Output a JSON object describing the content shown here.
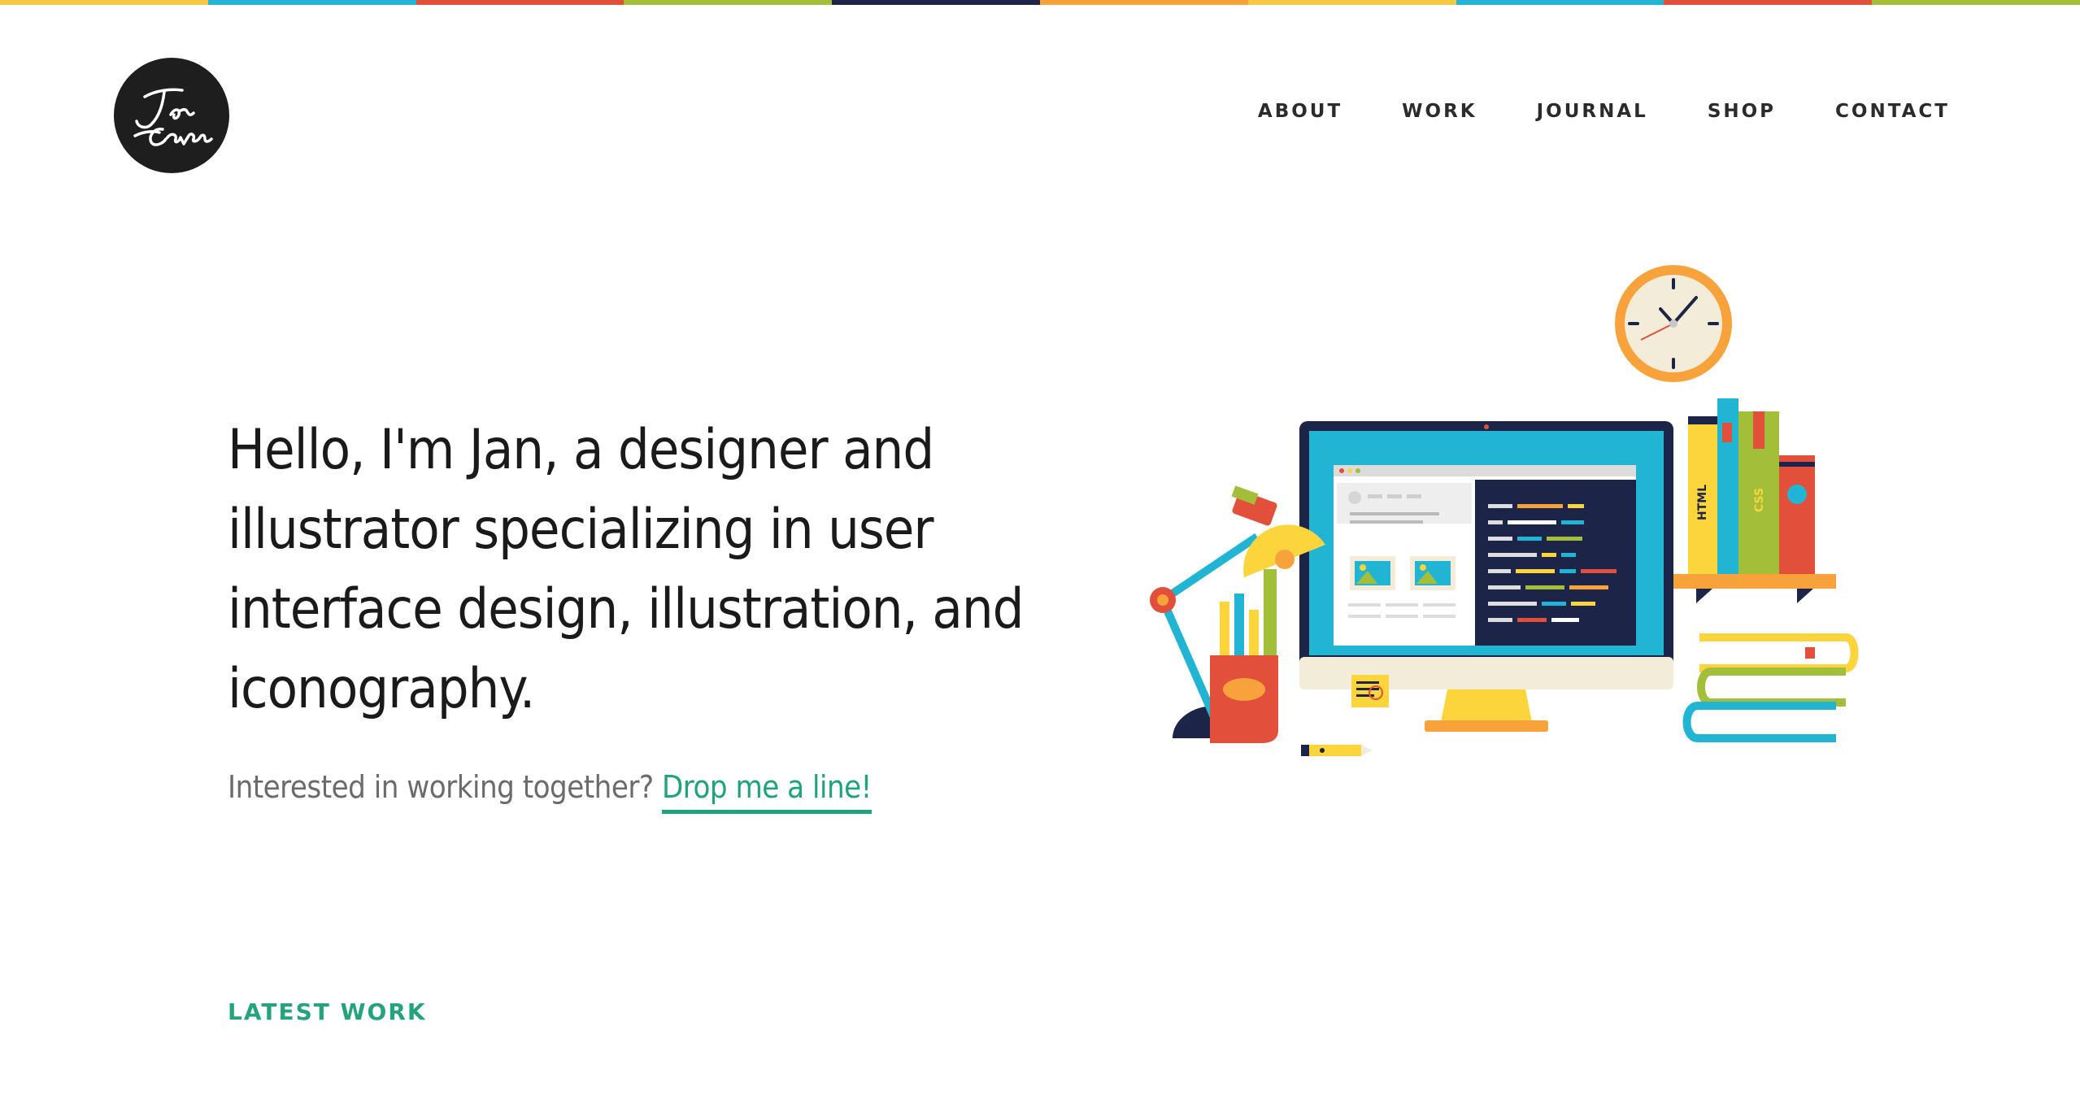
{
  "logo": {
    "text": "Jan Cavan",
    "color": "#1e1e1e"
  },
  "topbar_colors": [
    "#f7c843",
    "#22b5d3",
    "#e2503b",
    "#a3bf3a",
    "#1c2547",
    "#f7a23b",
    "#f7c843",
    "#22b5d3",
    "#e2503b",
    "#a3bf3a"
  ],
  "nav": {
    "about": "ABOUT",
    "work": "WORK",
    "journal": "JOURNAL",
    "shop": "SHOP",
    "contact": "CONTACT"
  },
  "hero": {
    "headline": "Hello, I'm Jan, a designer and illustrator specializing in user interface design, illustration, and iconography.",
    "cta_prefix": "Interested in working together?",
    "cta_link": "Drop me a line!"
  },
  "section": {
    "latest_work": "LATEST WORK"
  },
  "illustration": {
    "book_html": "HTML",
    "book_css": "CSS"
  },
  "colors": {
    "accent_green": "#1ea37a",
    "yellow": "#fcd43b",
    "blue": "#22b5d3",
    "red": "#e2503b",
    "olive": "#a3bf3a",
    "navy": "#1c2547",
    "orange": "#f7a23b"
  }
}
